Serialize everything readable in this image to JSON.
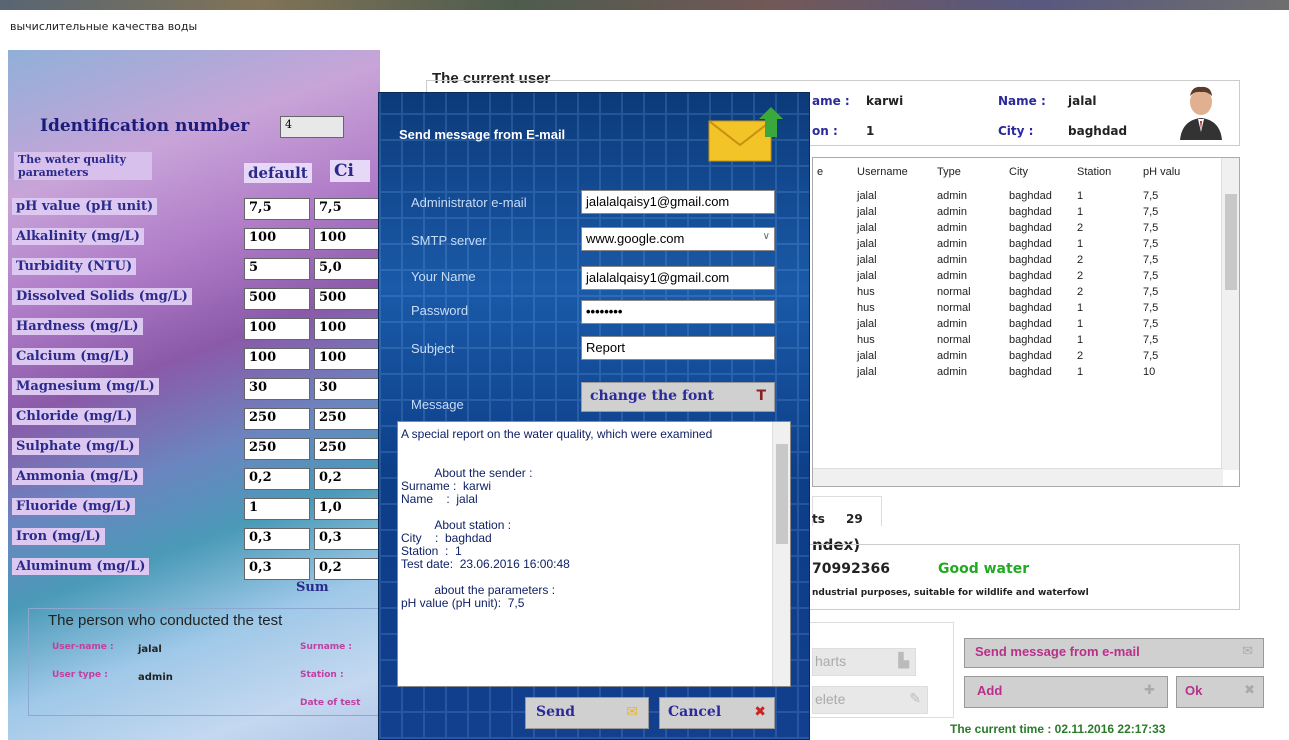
{
  "window": {
    "title": "вычислительные качества воды"
  },
  "left": {
    "id_label": "Identification number",
    "id_value": "4",
    "params_header": "The water quality parameters",
    "default_header": "default",
    "ci_header": "Ci",
    "params": [
      {
        "label": "pH value (pH unit)",
        "def": "7,5",
        "ci": "7,5"
      },
      {
        "label": "Alkalinity (mg/L)",
        "def": "100",
        "ci": "100"
      },
      {
        "label": "Turbidity (NTU)",
        "def": "5",
        "ci": "5,0"
      },
      {
        "label": "Dissolved Solids (mg/L)",
        "def": "500",
        "ci": "500"
      },
      {
        "label": "Hardness (mg/L)",
        "def": "100",
        "ci": "100"
      },
      {
        "label": "Calcium (mg/L)",
        "def": "100",
        "ci": "100"
      },
      {
        "label": "Magnesium (mg/L)",
        "def": "30",
        "ci": "30"
      },
      {
        "label": "Chloride (mg/L)",
        "def": "250",
        "ci": "250"
      },
      {
        "label": "Sulphate (mg/L)",
        "def": "250",
        "ci": "250"
      },
      {
        "label": "Ammonia (mg/L)",
        "def": "0,2",
        "ci": "0,2"
      },
      {
        "label": "Fluoride (mg/L)",
        "def": "1",
        "ci": "1,0"
      },
      {
        "label": "Iron (mg/L)",
        "def": "0,3",
        "ci": "0,3"
      },
      {
        "label": "Aluminum (mg/L)",
        "def": "0,3",
        "ci": "0,2"
      }
    ],
    "sum_label": "Sum",
    "person_title": "The person who conducted the test",
    "username_label": "User-name :",
    "username_value": "jalal",
    "usertype_label": "User type :",
    "usertype_value": "admin",
    "surname_label": "Surname :",
    "station_label": "Station :",
    "date_label": "Date of test"
  },
  "current_user": {
    "title": "The current user",
    "surname_label": "ame :",
    "surname_value": "karwi",
    "name_label": "Name :",
    "name_value": "jalal",
    "station_label": "on :",
    "station_value": "1",
    "city_label": "City :",
    "city_value": "baghdad"
  },
  "table": {
    "headers": [
      "e",
      "Username",
      "Type",
      "City",
      "Station",
      "pH valu"
    ],
    "rows": [
      [
        "",
        "jalal",
        "admin",
        "baghdad",
        "1",
        "7,5"
      ],
      [
        "",
        "jalal",
        "admin",
        "baghdad",
        "1",
        "7,5"
      ],
      [
        "",
        "jalal",
        "admin",
        "baghdad",
        "2",
        "7,5"
      ],
      [
        "",
        "jalal",
        "admin",
        "baghdad",
        "1",
        "7,5"
      ],
      [
        "",
        "jalal",
        "admin",
        "baghdad",
        "2",
        "7,5"
      ],
      [
        "",
        "jalal",
        "admin",
        "baghdad",
        "2",
        "7,5"
      ],
      [
        "",
        "hus",
        "normal",
        "baghdad",
        "2",
        "7,5"
      ],
      [
        "",
        "hus",
        "normal",
        "baghdad",
        "1",
        "7,5"
      ],
      [
        "",
        "jalal",
        "admin",
        "baghdad",
        "1",
        "7,5"
      ],
      [
        "",
        "hus",
        "normal",
        "baghdad",
        "1",
        "7,5"
      ],
      [
        "",
        "jalal",
        "admin",
        "baghdad",
        "2",
        "7,5"
      ],
      [
        "",
        "jalal",
        "admin",
        "baghdad",
        "1",
        "10"
      ]
    ]
  },
  "results": {
    "count_label": "ts",
    "count_value": "29",
    "index_label": "ndex)",
    "index_value": "70992366",
    "quality": "Good water",
    "description": "ndustrial purposes, suitable for wildlife and waterfowl"
  },
  "buttons": {
    "charts": "harts",
    "delete": "elete",
    "send_email": "Send message from e-mail",
    "add": "Add",
    "ok": "Ok"
  },
  "time": "The current time : 02.11.2016 22:17:33",
  "dialog": {
    "title": "Send message from E-mail",
    "admin_email_label": "Administrator e-mail",
    "admin_email": "jalalalqaisy1@gmail.com",
    "smtp_label": "SMTP server",
    "smtp": "www.google.com",
    "name_label": "Your Name",
    "name": "jalalalqaisy1@gmail.com",
    "password_label": "Password",
    "password": "••••••••",
    "subject_label": "Subject",
    "subject": "Report",
    "message_label": "Message",
    "change_font": "change the font",
    "message": "A special report on the water quality, which were examined\n\n\n          About the sender :\nSurname :  karwi\nName    :  jalal\n\n          About station :\nCity    :  baghdad\nStation  :  1\nTest date:  23.06.2016 16:00:48\n\n          about the parameters :\npH value (pH unit):  7,5",
    "send": "Send",
    "cancel": "Cancel"
  },
  "colors": {
    "accent": "#2a2a9a",
    "good": "#22aa22",
    "dialog_bg": "#1a5aa8",
    "time": "#2a7a2a"
  }
}
